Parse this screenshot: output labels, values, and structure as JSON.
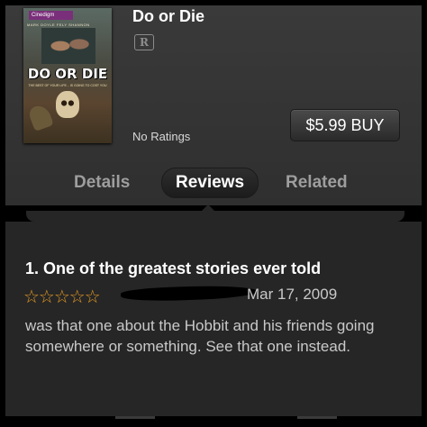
{
  "movie": {
    "title": "Do or Die",
    "rating_badge": "R",
    "ratings_text": "No Ratings",
    "buy_label": "$5.99 BUY"
  },
  "poster": {
    "studio": "Cinedigm",
    "cast_line": "MARK DOYLE    FELY SHANNON",
    "title_text": "DO OR DIE",
    "tagline": "THE BEST OF YOUR LIFE... IS GOING TO COST YOU"
  },
  "tabs": [
    {
      "label": "Details",
      "selected": false
    },
    {
      "label": "Reviews",
      "selected": true
    },
    {
      "label": "Related",
      "selected": false
    }
  ],
  "review": {
    "title": "1. One of the greatest stories ever told",
    "stars_display": "☆☆☆☆☆",
    "rating_stars": 0,
    "date": "Mar 17, 2009",
    "body": "was that one about the Hobbit and his friends going somewhere or something. See that one instead."
  },
  "colors": {
    "star": "#e59a24",
    "header_bg": "#333333",
    "content_bg": "#262626"
  }
}
